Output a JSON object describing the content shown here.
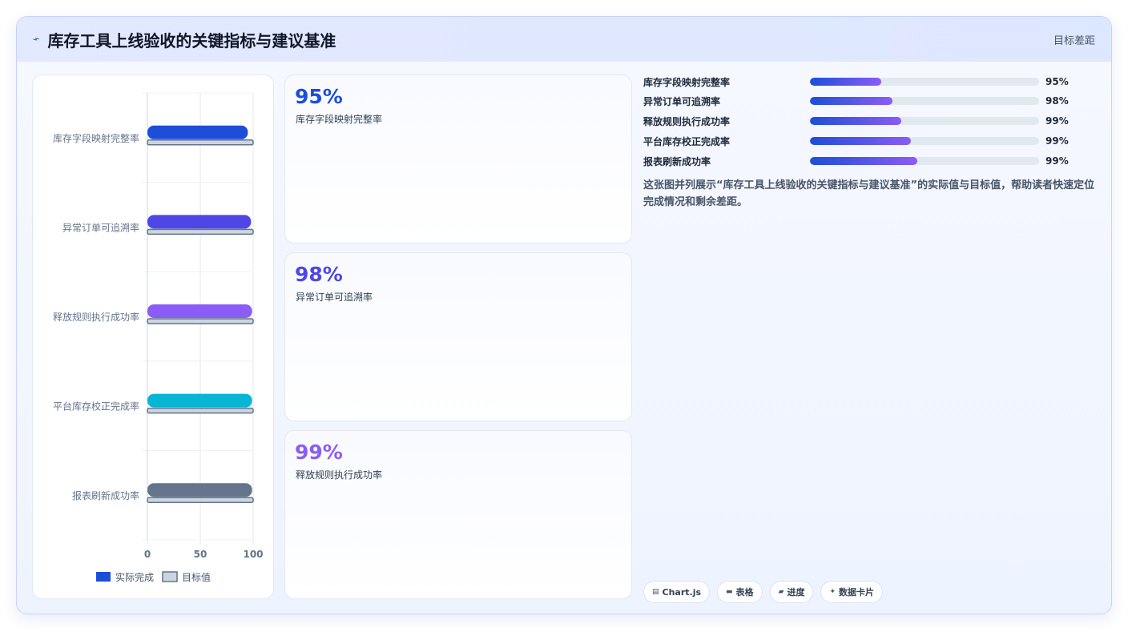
{
  "header": {
    "title": "库存工具上线验收的关键指标与建议基准",
    "right_label": "目标差距",
    "icon": "pulse-icon"
  },
  "chart_data": {
    "type": "bar",
    "orientation": "horizontal",
    "categories": [
      "库存字段映射完整率",
      "异常订单可追溯率",
      "释放规则执行成功率",
      "平台库存校正完成率",
      "报表刷新成功率"
    ],
    "series": [
      {
        "name": "实际完成",
        "values": [
          95,
          98,
          99,
          99,
          99
        ],
        "colors": [
          "#1d4ed8",
          "#4f46e5",
          "#8b5cf6",
          "#06b6d4",
          "#64748b"
        ]
      },
      {
        "name": "目标值",
        "values": [
          100,
          100,
          100,
          100,
          100
        ],
        "color": "#cbd5e1"
      }
    ],
    "x_ticks": [
      "0",
      "50",
      "100"
    ],
    "xlim": [
      0,
      100
    ],
    "grid": true,
    "legend": "bottom"
  },
  "kpis": [
    {
      "value": "95%",
      "label": "库存字段映射完整率",
      "color": "#1d4ed8"
    },
    {
      "value": "98%",
      "label": "异常订单可追溯率",
      "color": "#4f46e5"
    },
    {
      "value": "99%",
      "label": "释放规则执行成功率",
      "color": "#8b5cf6"
    }
  ],
  "progress": [
    {
      "label": "库存字段映射完整率",
      "value_text": "95%",
      "fill": 0.31
    },
    {
      "label": "异常订单可追溯率",
      "value_text": "98%",
      "fill": 0.36
    },
    {
      "label": "释放规则执行成功率",
      "value_text": "99%",
      "fill": 0.4
    },
    {
      "label": "平台库存校正完成率",
      "value_text": "99%",
      "fill": 0.44
    },
    {
      "label": "报表刷新成功率",
      "value_text": "99%",
      "fill": 0.47
    }
  ],
  "description": "这张图并列展示“库存工具上线验收的关键指标与建议基准”的实际值与目标值，帮助读者快速定位完成情况和剩余差距。",
  "chips": [
    {
      "icon": "bar-chart-icon",
      "glyph": "▤",
      "label": "Chart.js"
    },
    {
      "icon": "table-icon",
      "glyph": "▬",
      "label": "表格"
    },
    {
      "icon": "progress-icon",
      "glyph": "▰",
      "label": "进度"
    },
    {
      "icon": "sparkle-icon",
      "glyph": "✦",
      "label": "数据卡片"
    }
  ]
}
